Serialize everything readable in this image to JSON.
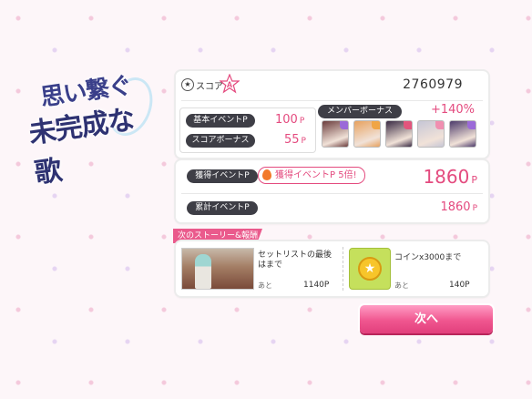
{
  "logo": {
    "line1": "思い繋ぐ",
    "line2": "未完成な歌"
  },
  "score": {
    "icon": "star-icon",
    "label": "スコア",
    "rank": "A",
    "value": "2760979"
  },
  "bonus": {
    "basic_label": "基本イベントP",
    "basic_value": "100",
    "basic_unit": "P",
    "score_label": "スコアボーナス",
    "score_value": "55",
    "score_unit": "P"
  },
  "member": {
    "label": "メンバーボーナス",
    "percent": "+140%",
    "characters": [
      {
        "name": "member-card-1",
        "color": "#6b3d3d",
        "badge": "#9b6ad8"
      },
      {
        "name": "member-card-2",
        "color": "#e7a25f",
        "badge": "#f0a545"
      },
      {
        "name": "member-card-3",
        "color": "#3a2b44",
        "badge": "#e2557c"
      },
      {
        "name": "member-card-4",
        "color": "#c6c6d6",
        "badge": "#f08fb0"
      },
      {
        "name": "member-card-5",
        "color": "#4d3b6b",
        "badge": "#9b6ad8"
      }
    ]
  },
  "event": {
    "label": "獲得イベントP",
    "badge": "獲得イベントP 5倍!",
    "value": "1860",
    "unit": "P",
    "total_label": "累計イベントP",
    "total_value": "1860",
    "total_unit": "P"
  },
  "story": {
    "tag": "次のストーリー&報酬",
    "item1": {
      "text_line1": "セットリストの最後",
      "text_line2": "はまで",
      "ato": "あと",
      "value": "1140P"
    },
    "item2": {
      "text": "コインx3000まで",
      "ato": "あと",
      "value": "140P"
    }
  },
  "next_button": "次へ",
  "colors": {
    "accent": "#e44b7f",
    "pill": "#3e3e46"
  }
}
